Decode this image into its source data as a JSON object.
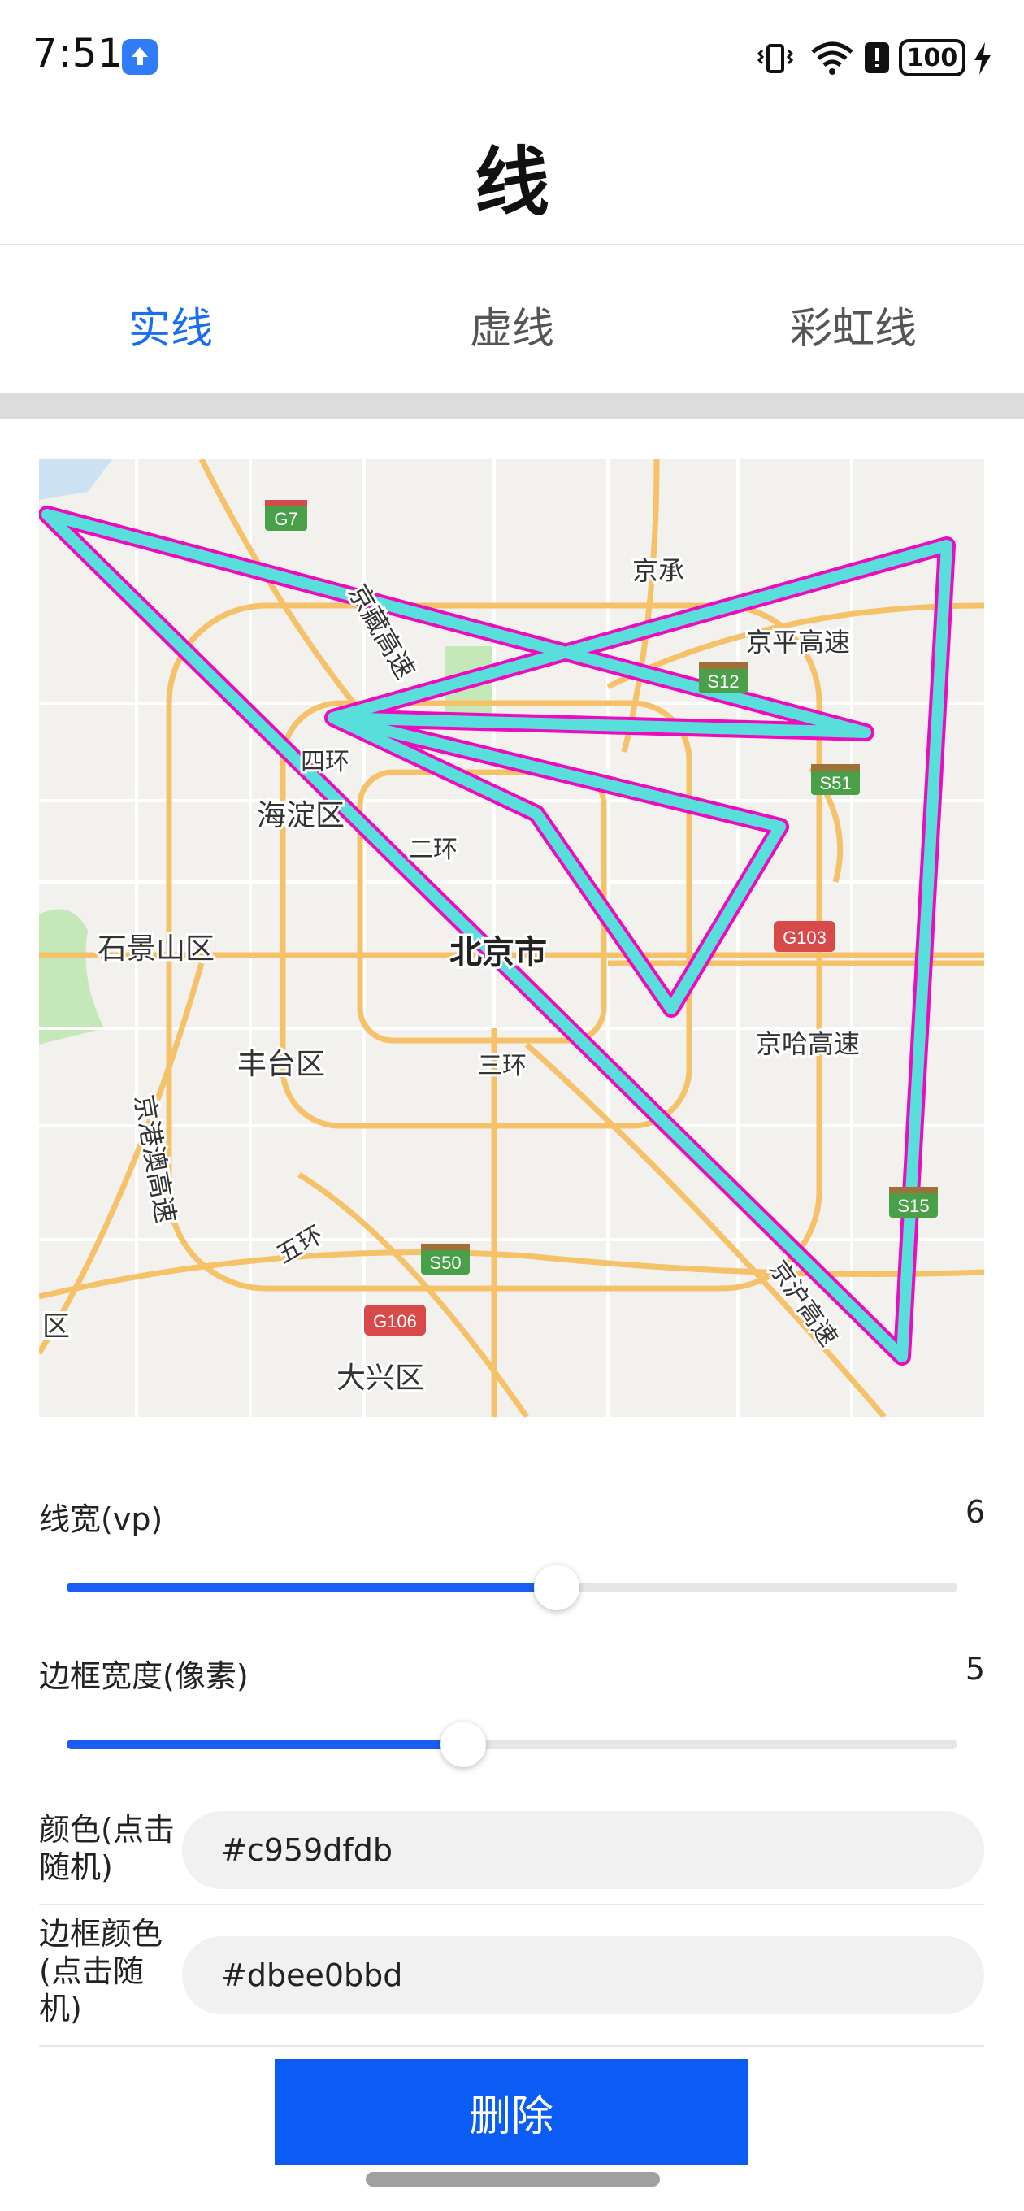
{
  "status_bar": {
    "time": "7:51",
    "battery": "100",
    "icons": [
      "app-badge-icon",
      "vibrate-icon",
      "wifi-icon",
      "alert-icon",
      "battery-icon",
      "charging-icon"
    ]
  },
  "page": {
    "title": "线"
  },
  "tabs": [
    {
      "label": "实线",
      "active": true
    },
    {
      "label": "虚线",
      "active": false
    },
    {
      "label": "彩虹线",
      "active": false
    }
  ],
  "map": {
    "labels": {
      "g7": "G7",
      "s12": "S12",
      "s51": "S51",
      "g103": "G103",
      "s15": "S15",
      "s50": "S50",
      "g106": "G106",
      "jingping": "京平高速",
      "jingcheng": "京承",
      "jingzang": "京藏高速",
      "sihuan": "四环",
      "haidian": "海淀区",
      "erhuan": "二环",
      "shijingshan": "石景山区",
      "beijing": "北京市",
      "jingha": "京哈高速",
      "fengtai": "丰台区",
      "sanhuan": "三环",
      "jinggangao": "京港澳高速",
      "wuhuan": "五环",
      "jinghu": "京沪高速",
      "daxing": "大兴区",
      "edge_qu": "区"
    },
    "polyline_color": "#59dfdb",
    "polyline_border_color": "#ee0bbd"
  },
  "sliders": [
    {
      "label": "线宽(vp)",
      "value": "6",
      "fraction": 0.55
    },
    {
      "label": "边框宽度(像素)",
      "value": "5",
      "fraction": 0.445
    }
  ],
  "inputs": [
    {
      "label": "颜色(点击随机)",
      "value": "#c959dfdb"
    },
    {
      "label": "边框颜色(点击随机)",
      "value": "#dbee0bbd"
    }
  ],
  "delete_button": {
    "label": "删除"
  },
  "colors": {
    "accent": "#1a6ef2",
    "button": "#0a5cf5"
  }
}
